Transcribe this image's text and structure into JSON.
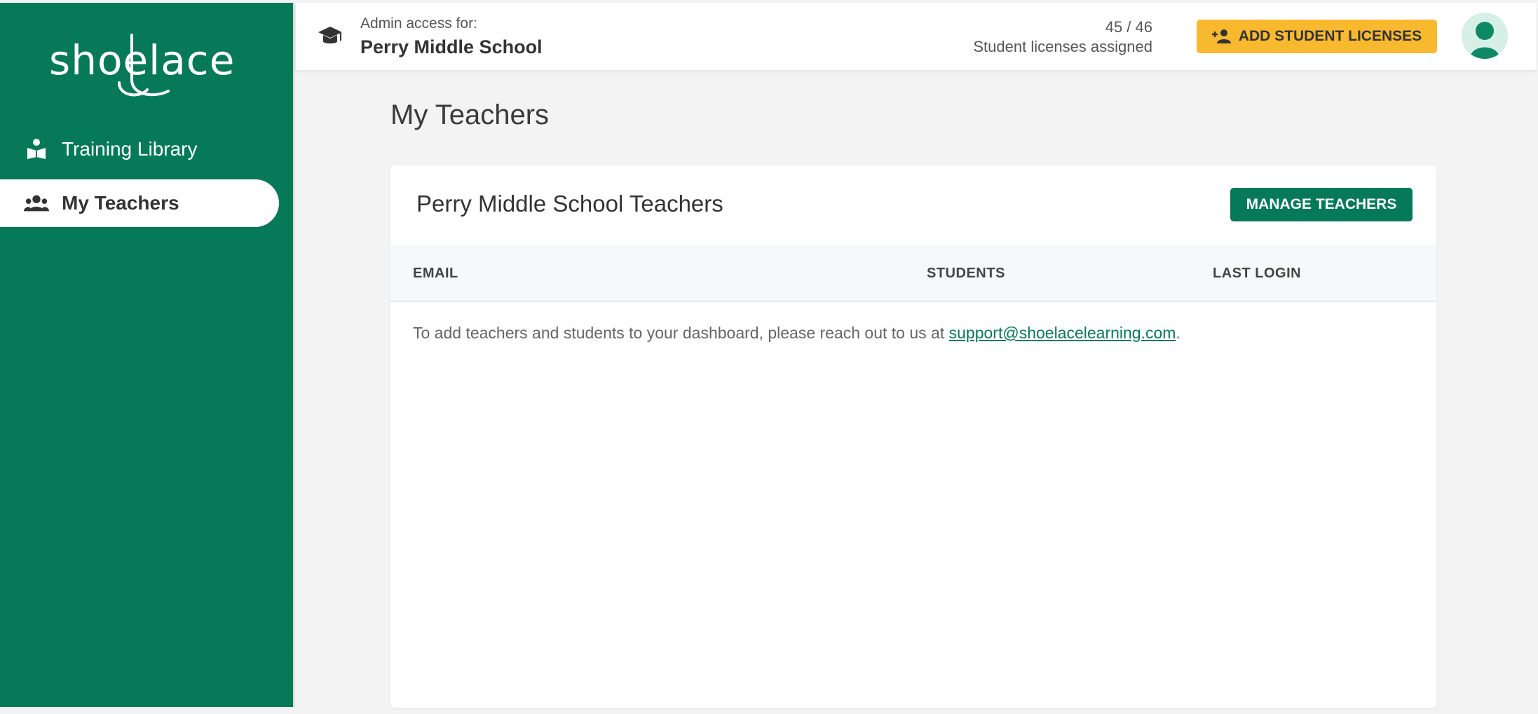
{
  "brand": {
    "logo_text": "shoelace",
    "primary_color": "#067a58",
    "accent_color": "#f8b92f"
  },
  "sidebar": {
    "items": [
      {
        "label": "Training Library",
        "icon": "book-reader-icon",
        "active": false
      },
      {
        "label": "My Teachers",
        "icon": "users-icon",
        "active": true
      }
    ]
  },
  "header": {
    "icon": "graduation-cap-icon",
    "admin_label": "Admin access for:",
    "school_name": "Perry Middle School",
    "license_count": "45 / 46",
    "license_label": "Student licenses assigned",
    "add_licenses_label": "ADD STUDENT LICENSES",
    "add_licenses_icon": "add-person-icon",
    "avatar_icon": "user-avatar-icon"
  },
  "main": {
    "title": "My Teachers",
    "card": {
      "title": "Perry Middle School Teachers",
      "manage_label": "MANAGE TEACHERS",
      "columns": [
        "EMAIL",
        "STUDENTS",
        "LAST LOGIN"
      ],
      "empty_message": "To add teachers and students to your dashboard, please reach out to us at ",
      "support_email": "support@shoelacelearning.com",
      "empty_message_end": "."
    }
  }
}
